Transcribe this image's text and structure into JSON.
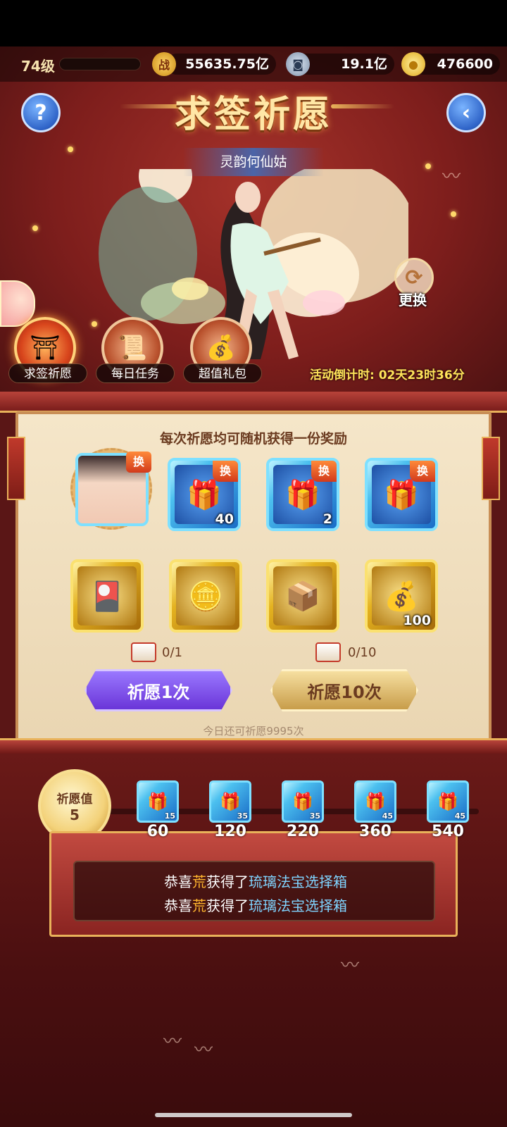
{
  "player": {
    "level": "74级"
  },
  "resources": [
    {
      "icon": "combat-power-icon",
      "icon_glyph": "战",
      "value": "55635.75亿"
    },
    {
      "icon": "coin-icon",
      "icon_glyph": "◙",
      "value": "19.1亿"
    },
    {
      "icon": "gold-ingot-icon",
      "icon_glyph": "●",
      "value": "476600"
    }
  ],
  "header": {
    "title": "求签祈愿",
    "help_glyph": "?",
    "back_glyph": "‹"
  },
  "hero": {
    "name": "灵韵何仙姑"
  },
  "refresh": {
    "label": "更换",
    "glyph": "⟳"
  },
  "features": [
    {
      "label": "求签祈愿",
      "glyph": "⛩"
    },
    {
      "label": "每日任务",
      "glyph": "📜"
    },
    {
      "label": "超值礼包",
      "glyph": "💰"
    }
  ],
  "countdown": {
    "text": "活动倒计时: 02天23时36分"
  },
  "panel": {
    "subtitle": "每次祈愿均可随机获得一份奖励",
    "swap_badge": "换",
    "row1": [
      {
        "type": "portrait",
        "qty": ""
      },
      {
        "type": "blue-chest",
        "qty": "40",
        "glyph": "🎁"
      },
      {
        "type": "blue-chest",
        "qty": "2",
        "glyph": "🎁"
      },
      {
        "type": "blue-chest",
        "qty": "",
        "glyph": "🎁"
      }
    ],
    "row2": [
      {
        "qty": "",
        "glyph": "🎴"
      },
      {
        "qty": "",
        "glyph": "🪙"
      },
      {
        "qty": "",
        "glyph": "📦"
      },
      {
        "qty": "100",
        "glyph": "💰"
      }
    ],
    "ticket_counts": [
      "0/1",
      "0/10"
    ],
    "wish_once": "祈愿1次",
    "wish_ten": "祈愿10次",
    "remaining": "今日还可祈愿9995次"
  },
  "wish_value": {
    "label": "祈愿值",
    "value": "5"
  },
  "milestones": [
    {
      "threshold": "60",
      "qty": "15"
    },
    {
      "threshold": "120",
      "qty": "35"
    },
    {
      "threshold": "220",
      "qty": "35"
    },
    {
      "threshold": "360",
      "qty": "45"
    },
    {
      "threshold": "540",
      "qty": "45"
    }
  ],
  "news": [
    {
      "prefix": "恭喜",
      "name": "荒",
      "middle": "获得了",
      "item": "琉璃法宝选择箱"
    },
    {
      "prefix": "恭喜",
      "name": "荒",
      "middle": "获得了",
      "item": "琉璃法宝选择箱"
    }
  ],
  "colors": {
    "accent_gold": "#ffe7a6",
    "panel_bg": "#f5e6c9",
    "wish_purple": "#6a35d8",
    "wish_gold": "#c89d4a"
  }
}
